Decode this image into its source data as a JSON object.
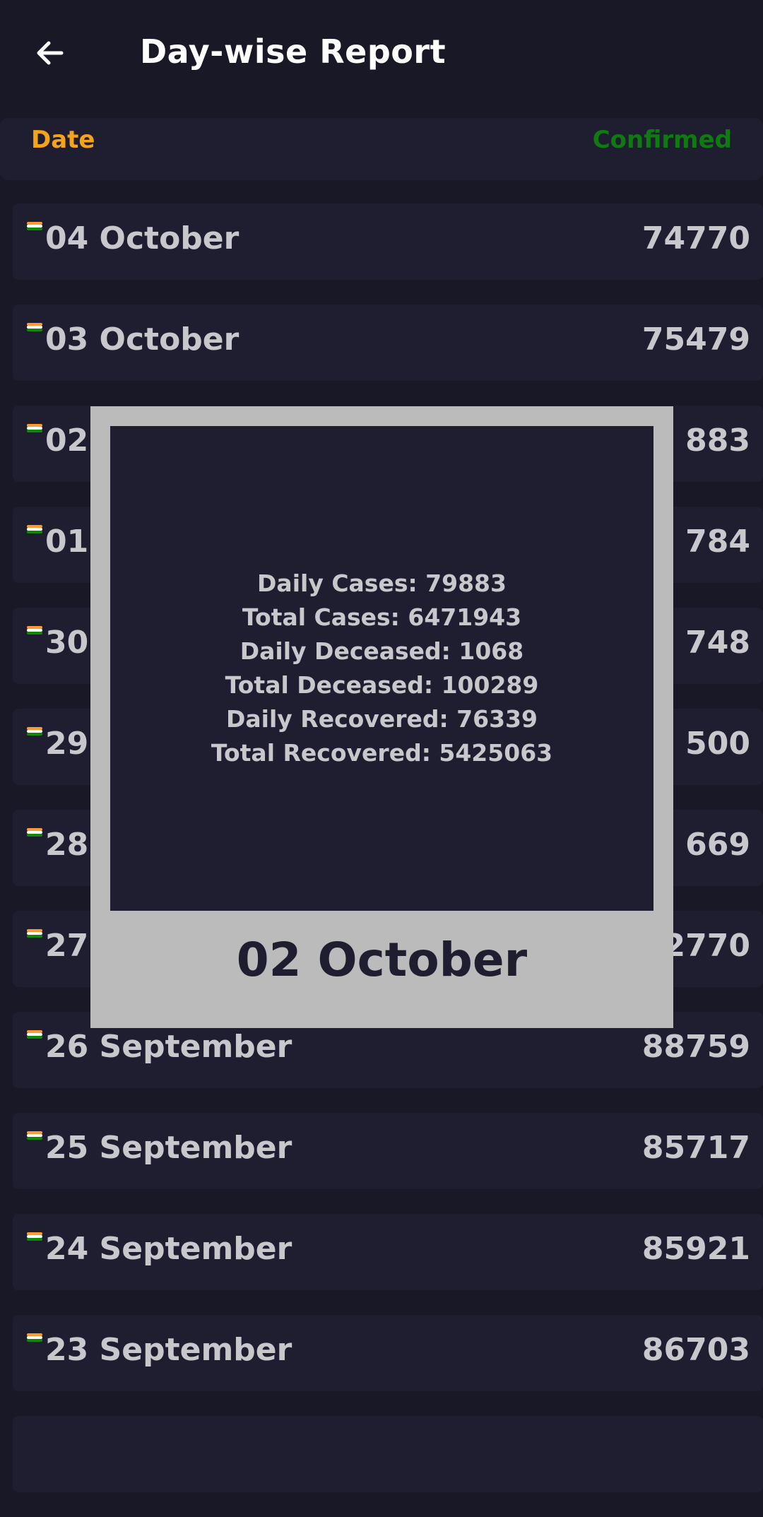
{
  "app": {
    "title": "Day-wise Report"
  },
  "table_header": {
    "date_label": "Date",
    "confirmed_label": "Confirmed"
  },
  "rows": [
    {
      "date": "04 October",
      "confirmed": "74770"
    },
    {
      "date": "03 October",
      "confirmed": "75479"
    },
    {
      "date": "02",
      "confirmed": "883"
    },
    {
      "date": "01 (",
      "confirmed": "784"
    },
    {
      "date": "30",
      "confirmed": "748"
    },
    {
      "date": "29",
      "confirmed": "500"
    },
    {
      "date": "28",
      "confirmed": "669"
    },
    {
      "date": "27",
      "confirmed": "2770"
    },
    {
      "date": "26 September",
      "confirmed": "88759"
    },
    {
      "date": "25 September",
      "confirmed": "85717"
    },
    {
      "date": "24 September",
      "confirmed": "85921"
    },
    {
      "date": "23 September",
      "confirmed": "86703"
    }
  ],
  "popup": {
    "lines": [
      "Daily Cases: 79883",
      "Total Cases: 6471943",
      "Daily Deceased: 1068",
      "Total Deceased: 100289",
      "Daily Recovered: 76339",
      "Total Recovered: 5425063"
    ],
    "date": "02 October"
  },
  "colors": {
    "background": "#191826",
    "card": "#1f1e30",
    "date_header": "#f5a31a",
    "confirmed_header": "#0f7a12",
    "row_text": "#c8c7cc",
    "popup_frame": "#bbbbbb",
    "flag_saffron": "#ff9933",
    "flag_white": "#ffffff",
    "flag_green": "#138808"
  },
  "icons": {
    "back": "arrow-left-icon",
    "flag": "india-flag-icon"
  }
}
